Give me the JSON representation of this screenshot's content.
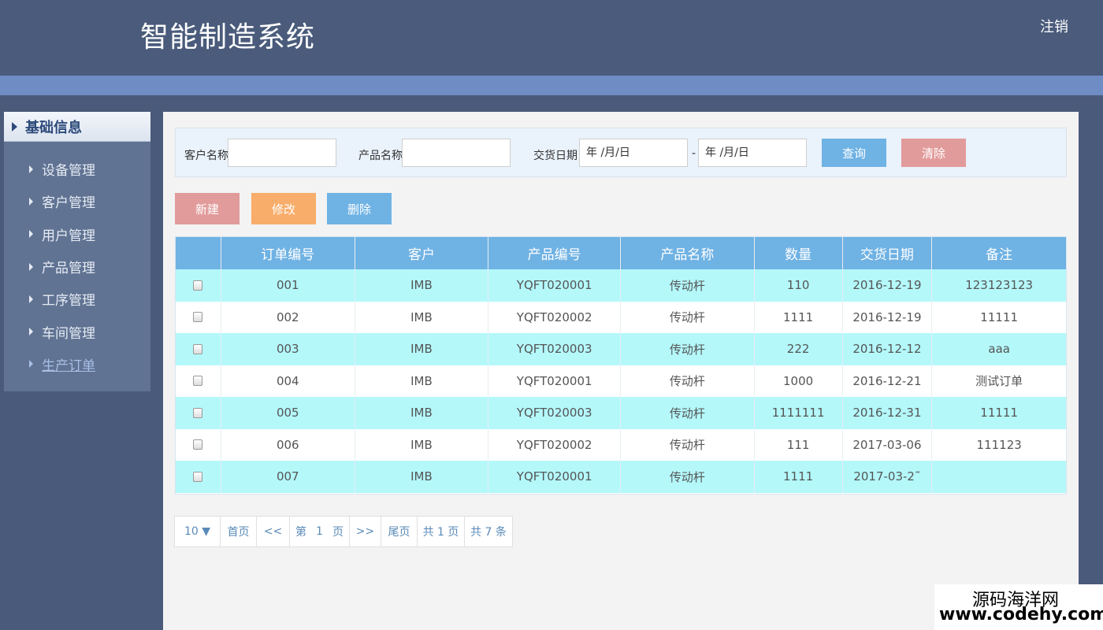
{
  "header": {
    "title": "智能制造系统",
    "logout": "注销"
  },
  "sidebar": {
    "heading": "基础信息",
    "items": [
      "设备管理",
      "客户管理",
      "用户管理",
      "产品管理",
      "工序管理",
      "车间管理",
      "生产订单"
    ],
    "active_index": 6
  },
  "filter": {
    "customer_label": "客户名称",
    "customer_value": "",
    "product_label": "产品名称",
    "product_value": "",
    "date_label": "交货日期",
    "date_from": "年 /月/日",
    "date_sep": "-",
    "date_to": "年 /月/日",
    "query": "查询",
    "clear": "清除"
  },
  "actions": {
    "new": "新建",
    "edit": "修改",
    "delete": "删除"
  },
  "table": {
    "columns": [
      "",
      "订单编号",
      "客户",
      "产品编号",
      "产品名称",
      "数量",
      "交货日期",
      "备注"
    ],
    "rows": [
      [
        "001",
        "IMB",
        "YQFT020001",
        "传动杆",
        "110",
        "2016-12-19",
        "123123123"
      ],
      [
        "002",
        "IMB",
        "YQFT020002",
        "传动杆",
        "1111",
        "2016-12-19",
        "11111"
      ],
      [
        "003",
        "IMB",
        "YQFT020003",
        "传动杆",
        "222",
        "2016-12-12",
        "aaa"
      ],
      [
        "004",
        "IMB",
        "YQFT020001",
        "传动杆",
        "1000",
        "2016-12-21",
        "测试订单"
      ],
      [
        "005",
        "IMB",
        "YQFT020003",
        "传动杆",
        "1111111",
        "2016-12-31",
        "11111"
      ],
      [
        "006",
        "IMB",
        "YQFT020002",
        "传动杆",
        "111",
        "2017-03-06",
        "111123"
      ],
      [
        "007",
        "IMB",
        "YQFT020001",
        "传动杆",
        "1111",
        "2017-03-2˜",
        ""
      ]
    ]
  },
  "pager": {
    "page_size": "10 ▼",
    "first": "首页",
    "prev": "<<",
    "page_prefix": "第",
    "page_num": "1",
    "page_suffix": "页",
    "next": ">>",
    "last": "尾页",
    "total_pages": "共 1 页",
    "total_count": "共 7 条"
  },
  "watermark": {
    "line1": "源码海洋网",
    "line2": "www.codehy.com"
  },
  "colors": {
    "header": "#4a5b7b",
    "stripe": "#6f8cc4",
    "table_head": "#6fb2e4",
    "row_alt": "#b4f8fa",
    "btn_new": "#e29b9b",
    "btn_edit": "#f8ad6a",
    "btn_delete": "#6fb2e4",
    "btn_query": "#6fb2e4",
    "btn_clear": "#e29b9b"
  }
}
